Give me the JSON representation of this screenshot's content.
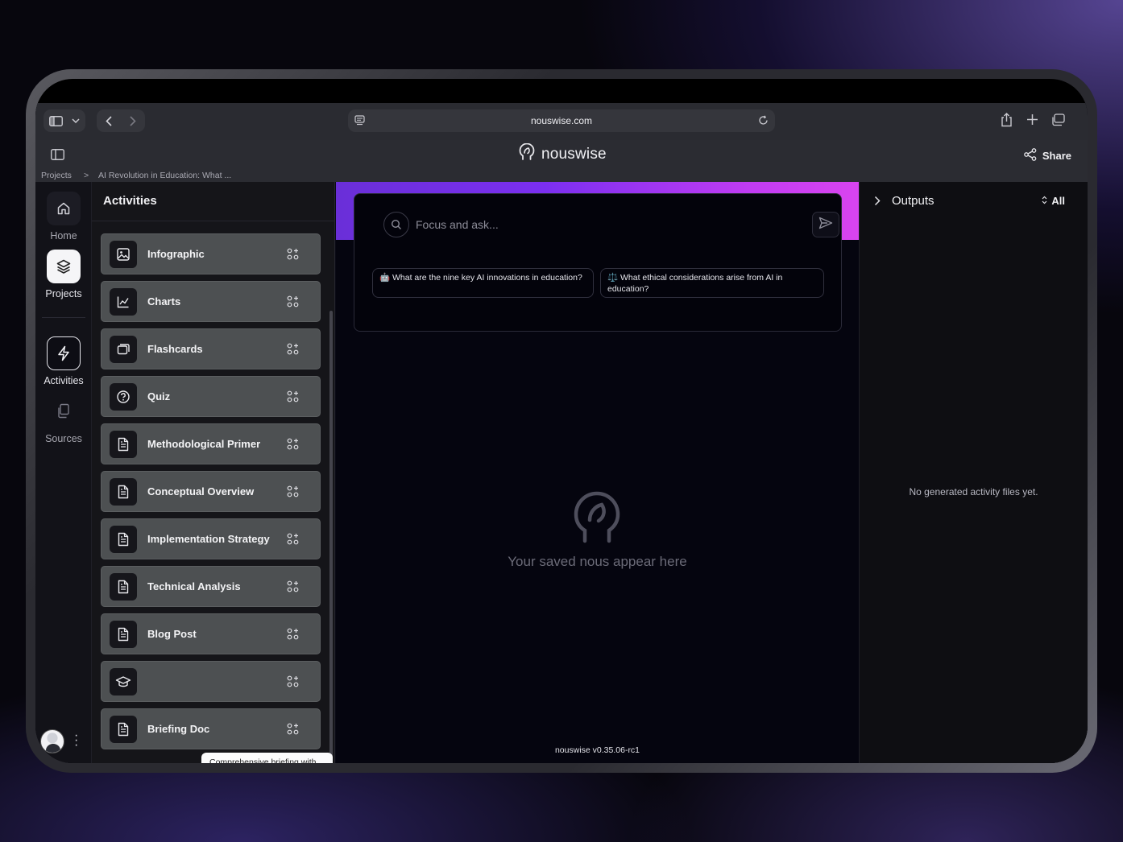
{
  "browser": {
    "url": "nouswise.com"
  },
  "app": {
    "brand": "nouswise",
    "share_label": "Share"
  },
  "breadcrumb": {
    "items": [
      "Projects",
      ">",
      "AI Revolution in Education: What ..."
    ]
  },
  "leftnav": {
    "home": "Home",
    "projects": "Projects",
    "activities": "Activities",
    "sources": "Sources"
  },
  "activities": {
    "title": "Activities",
    "items": [
      {
        "label": "Infographic",
        "icon": "image-icon"
      },
      {
        "label": "Charts",
        "icon": "chart-icon"
      },
      {
        "label": "Flashcards",
        "icon": "cards-icon"
      },
      {
        "label": "Quiz",
        "icon": "question-icon"
      },
      {
        "label": "Methodological Primer",
        "icon": "document-icon"
      },
      {
        "label": "Conceptual Overview",
        "icon": "document-icon"
      },
      {
        "label": "Implementation Strategy",
        "icon": "document-icon"
      },
      {
        "label": "Technical Analysis",
        "icon": "document-icon"
      },
      {
        "label": "Blog Post",
        "icon": "document-icon"
      },
      {
        "label": "",
        "icon": "graduation-cap-icon"
      },
      {
        "label": "Briefing Doc",
        "icon": "document-icon"
      }
    ],
    "tooltip": "Comprehensive briefing with executive summary, themes, evidence, and objective conclusions."
  },
  "center": {
    "ask_placeholder": "Focus and ask...",
    "suggestions": [
      {
        "emoji": "🤖",
        "text": "What are the nine key AI innovations in education?"
      },
      {
        "emoji": "⚖️",
        "text": "What ethical considerations arise from AI in education?"
      }
    ],
    "empty_text": "Your saved nous appear here",
    "version": "nouswise v0.35.06-rc1"
  },
  "outputs": {
    "title": "Outputs",
    "filter": "All",
    "empty_text": "No generated activity files yet."
  },
  "colors": {
    "accent_gradient_start": "#6a2fd8",
    "accent_gradient_end": "#d944f0",
    "activity_card": "#4d5052"
  }
}
